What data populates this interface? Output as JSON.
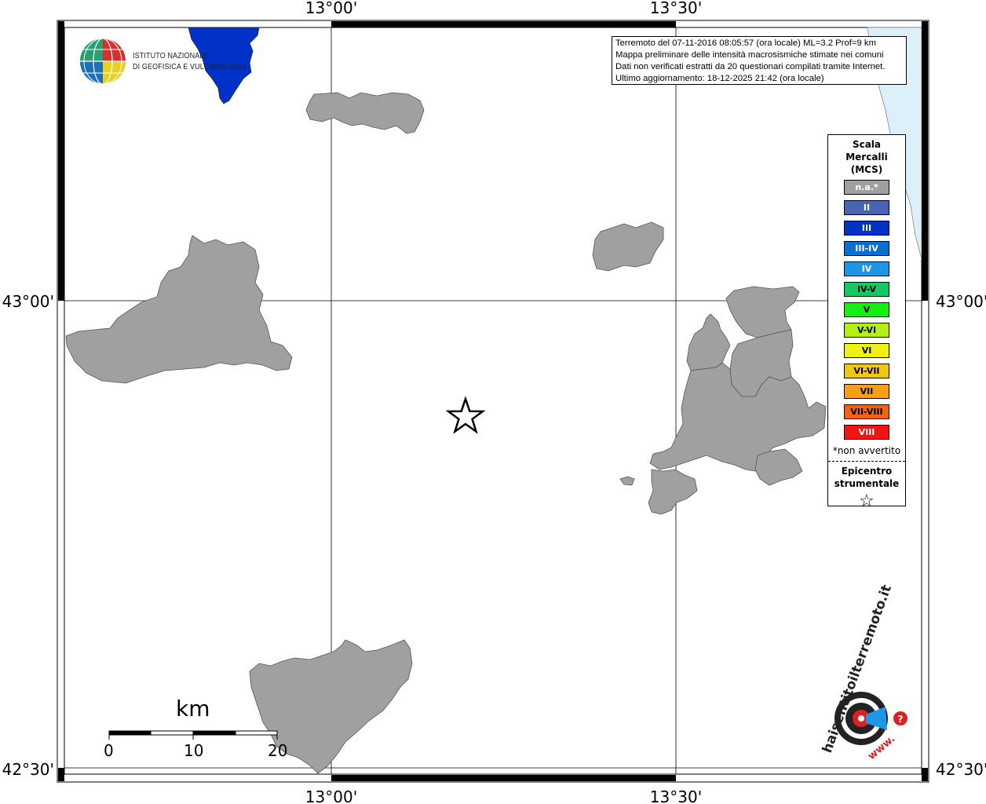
{
  "coordinates": {
    "lon_top_left": "13°00'",
    "lon_top_right": "13°30'",
    "lon_bottom_left": "13°00'",
    "lon_bottom_right": "13°30'",
    "lat_top_left": "43°00'",
    "lat_top_right": "43°00'",
    "lat_bottom_left": "42°30'",
    "lat_bottom_right": "42°30'"
  },
  "info": {
    "line1": "Terremoto del 07-11-2016 08:05:57 (ora locale) ML=3.2 Prof=9 km",
    "line2": "Mappa preliminare delle intensità macrosismiche stimate nei comuni",
    "line3": "Dati non verificati estratti da 20 questionari compilati tramite Internet.",
    "line4": "Ultimo aggiornamento: 18-12-2025 21:42 (ora locale)"
  },
  "logo": {
    "org_line1": "ISTITUTO NAZIONALE",
    "org_line2": "DI GEOFISICA E VULCANOLOGIA"
  },
  "legend": {
    "title_line1": "Scala",
    "title_line2": "Mercalli",
    "title_line3": "(MCS)",
    "items": [
      {
        "label": "n.a.*",
        "color": "#a0a0a0",
        "text_color": "#ffffff"
      },
      {
        "label": "II",
        "color": "#4a64b4",
        "text_color": "#ffffff"
      },
      {
        "label": "III",
        "color": "#0032c8",
        "text_color": "#ffffff"
      },
      {
        "label": "III-IV",
        "color": "#0a6ed2",
        "text_color": "#ffffff"
      },
      {
        "label": "IV",
        "color": "#1e96e6",
        "text_color": "#ffffff"
      },
      {
        "label": "IV-V",
        "color": "#14c864",
        "text_color": "#000000"
      },
      {
        "label": "V",
        "color": "#14f014",
        "text_color": "#000000"
      },
      {
        "label": "V-VI",
        "color": "#b4f014",
        "text_color": "#000000"
      },
      {
        "label": "VI",
        "color": "#f0f014",
        "text_color": "#000000"
      },
      {
        "label": "VI-VII",
        "color": "#f0c814",
        "text_color": "#000000"
      },
      {
        "label": "VII",
        "color": "#f5a014",
        "text_color": "#000000"
      },
      {
        "label": "VII-VIII",
        "color": "#f06414",
        "text_color": "#000000"
      },
      {
        "label": "VIII",
        "color": "#f01414",
        "text_color": "#ffffff"
      }
    ],
    "note": "*non avvertito",
    "epicenter_line1": "Epicentro",
    "epicenter_line2": "strumentale"
  },
  "scalebar": {
    "unit": "km",
    "labels": [
      "0",
      "10",
      "20"
    ]
  },
  "site_logo": {
    "text1": "haisentitoilterremoto.it",
    "text2": "www."
  },
  "colors": {
    "municipality_fill": "#a0a0a0",
    "intensity_III": "#0032c8",
    "sea": "#dcf0fa"
  }
}
